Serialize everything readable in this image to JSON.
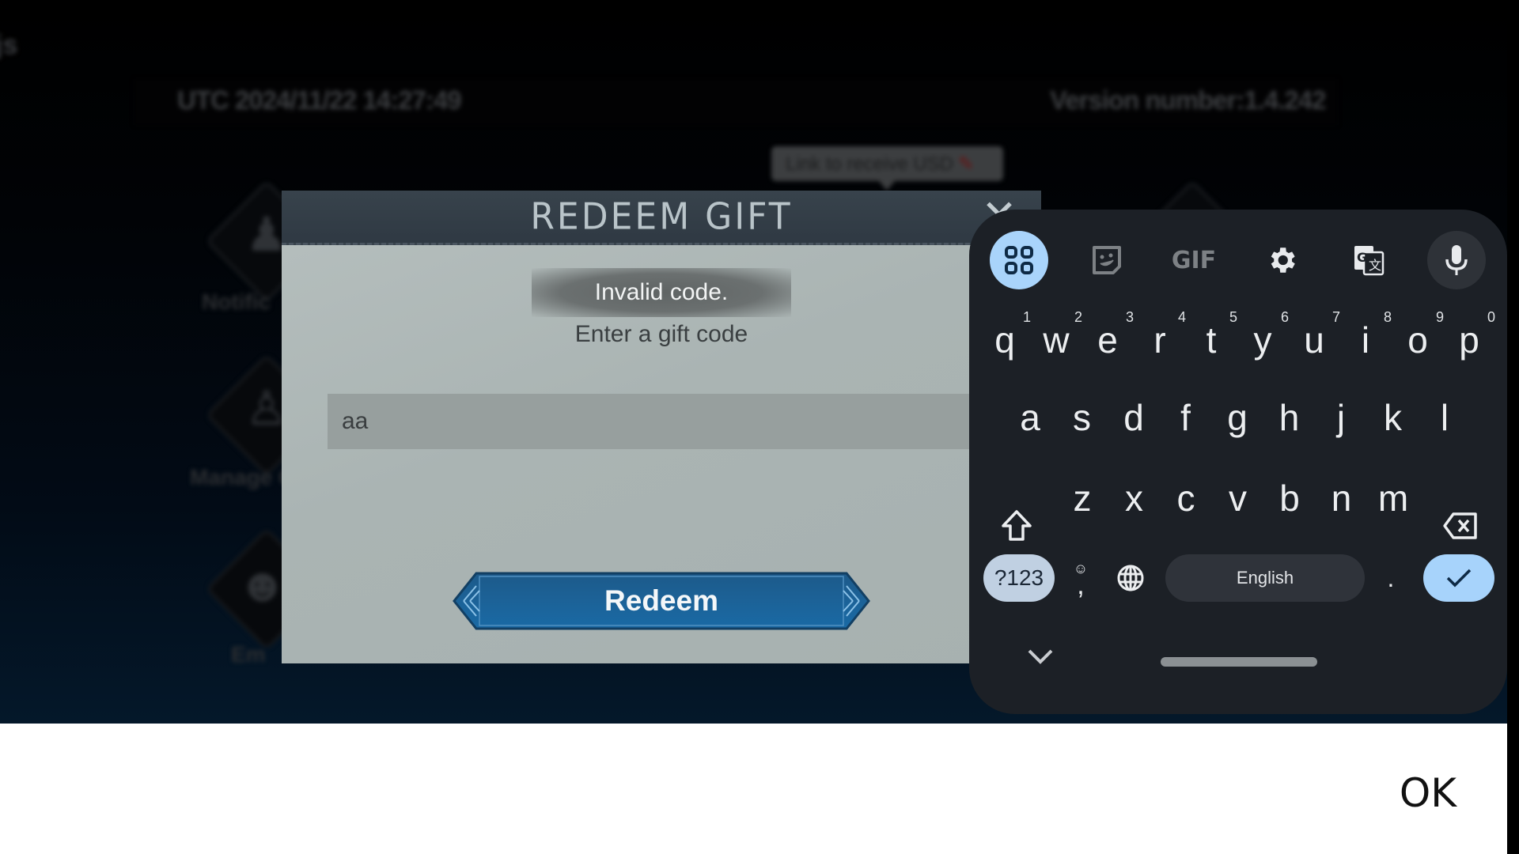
{
  "background": {
    "corner_text": "js",
    "utc_time": "UTC 2024/11/22 14:27:49",
    "version": "Version number:1.4.242",
    "tooltip": "Link to receive USD",
    "icon_labels": [
      "Notific",
      "Manage C",
      "Em"
    ]
  },
  "dialog": {
    "title": "REDEEM GIFT",
    "close_icon": "close-x-icon",
    "toast": "Invalid code.",
    "prompt": "Enter a gift code",
    "input_value": "aa",
    "button_label": "Redeem",
    "colors": {
      "button": "#1b5f93",
      "titlebar": "#333e47",
      "panel": "#aeb8b7"
    }
  },
  "keyboard": {
    "toolbar": [
      "apps-grid-icon",
      "sticker-icon",
      "gif-icon",
      "settings-gear-icon",
      "translate-icon",
      "microphone-icon"
    ],
    "gif_label": "GIF",
    "row1": [
      "q",
      "w",
      "e",
      "r",
      "t",
      "y",
      "u",
      "i",
      "o",
      "p"
    ],
    "row1_hints": [
      "1",
      "2",
      "3",
      "4",
      "5",
      "6",
      "7",
      "8",
      "9",
      "0"
    ],
    "row2": [
      "a",
      "s",
      "d",
      "f",
      "g",
      "h",
      "j",
      "k",
      "l"
    ],
    "row3": [
      "z",
      "x",
      "c",
      "v",
      "b",
      "n",
      "m"
    ],
    "symbols_label": "?123",
    "comma_label": ",",
    "space_label": "English",
    "period_label": ".",
    "accent_color": "#a8d3fb"
  },
  "bottom_bar": {
    "ok_label": "OK"
  }
}
